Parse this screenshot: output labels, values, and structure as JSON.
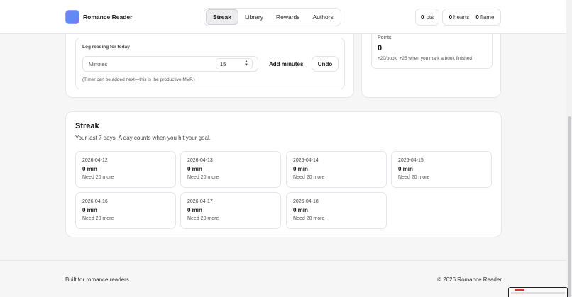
{
  "header": {
    "brand": "Romance Reader",
    "nav": [
      "Streak",
      "Library",
      "Rewards",
      "Authors"
    ],
    "active_tab": "Streak",
    "stats": {
      "pts_value": "0",
      "pts_label": "pts",
      "hearts_value": "0",
      "hearts_label": "hearts",
      "flame_value": "0",
      "flame_label": "flame"
    }
  },
  "log": {
    "title": "Log reading for today",
    "minutes_placeholder": "Minutes",
    "minutes_value": "15",
    "add_button": "Add minutes",
    "undo_button": "Undo",
    "note": "(Timer can be added next—this is the productive MVP.)"
  },
  "points": {
    "label": "Points",
    "value": "0",
    "note": "+20/book, +25 when you mark a book finished"
  },
  "streak": {
    "title": "Streak",
    "subtitle": "Your last 7 days. A day counts when you hit your goal.",
    "days": [
      {
        "date": "2026-04-12",
        "minutes": "0 min",
        "need": "Need 20 more"
      },
      {
        "date": "2026-04-13",
        "minutes": "0 min",
        "need": "Need 20 more"
      },
      {
        "date": "2026-04-14",
        "minutes": "0 min",
        "need": "Need 20 more"
      },
      {
        "date": "2026-04-15",
        "minutes": "0 min",
        "need": "Need 20 more"
      },
      {
        "date": "2026-04-16",
        "minutes": "0 min",
        "need": "Need 20 more"
      },
      {
        "date": "2026-04-17",
        "minutes": "0 min",
        "need": "Need 20 more"
      },
      {
        "date": "2026-04-18",
        "minutes": "0 min",
        "need": "Need 20 more"
      }
    ]
  },
  "footer": {
    "left": "Built for romance readers.",
    "right": "© 2026 Romance Reader"
  },
  "colors": {
    "accent_gradient_start": "#7b7cf4",
    "accent_gradient_end": "#5a8ef5",
    "page_bg": "#f6f6f7",
    "card_border": "#e6e6ea"
  }
}
